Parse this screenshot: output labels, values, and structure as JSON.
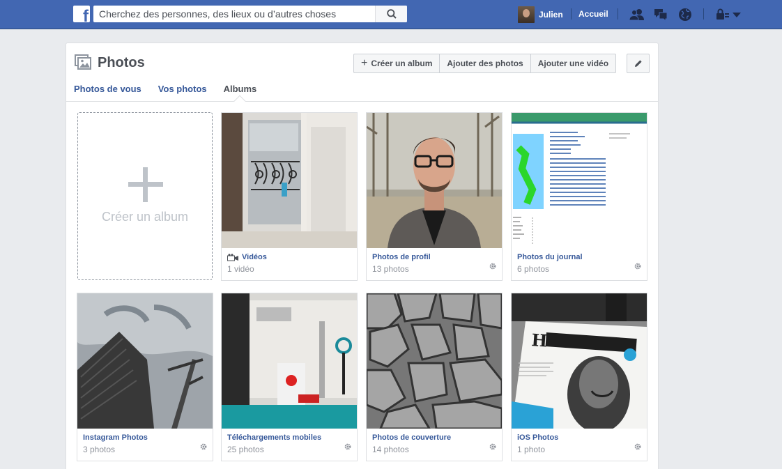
{
  "topbar": {
    "logo": "f",
    "search_placeholder": "Cherchez des personnes, des lieux ou d’autres choses",
    "user_name": "Julien",
    "home_label": "Accueil",
    "icons": [
      "friends-icon",
      "messages-icon",
      "notifications-globe-icon",
      "privacy-lock-icon",
      "account-menu-chevron-icon"
    ]
  },
  "header": {
    "title": "Photos",
    "buttons": {
      "create_album": "Créer un album",
      "add_photos": "Ajouter des photos",
      "add_video": "Ajouter une vidéo"
    }
  },
  "tabs": [
    {
      "label": "Photos de vous",
      "active": false
    },
    {
      "label": "Vos photos",
      "active": false
    },
    {
      "label": "Albums",
      "active": true
    }
  ],
  "create_tile": {
    "label": "Créer un album"
  },
  "albums": [
    {
      "name": "Vidéos",
      "count": "1 vidéo",
      "icon": "video-camera-icon",
      "thumb": "window-balcony"
    },
    {
      "name": "Photos de profil",
      "count": "13 photos",
      "thumb": "portrait-man-glasses"
    },
    {
      "name": "Photos du journal",
      "count": "6 photos",
      "thumb": "earthquake-report-document"
    },
    {
      "name": "Instagram Photos",
      "count": "3 photos",
      "thumb": "skyscraper-cloudy-sky"
    },
    {
      "name": "Téléchargements mobiles",
      "count": "25 photos",
      "thumb": "trade-show-booth"
    },
    {
      "name": "Photos de couverture",
      "count": "14 photos",
      "thumb": "cracked-earth-texture"
    },
    {
      "name": "iOS Photos",
      "count": "1 photo",
      "thumb": "humanoide-magazine-cover"
    }
  ],
  "colors": {
    "brand_blue": "#4267b2",
    "link_blue": "#365899",
    "page_bg": "#e9ebee"
  }
}
